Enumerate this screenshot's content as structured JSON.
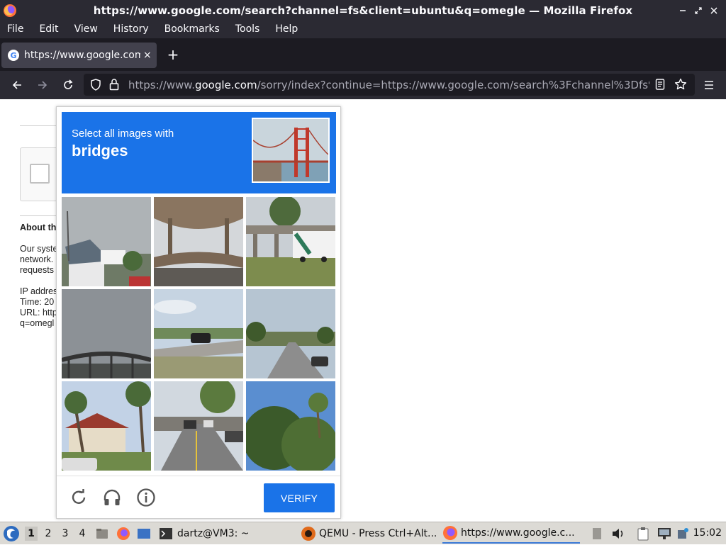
{
  "window": {
    "title": "https://www.google.com/search?channel=fs&client=ubuntu&q=omegle — Mozilla Firefox",
    "controls": {
      "minimize": "‒",
      "maximize": "⤡",
      "close": "✕"
    }
  },
  "menubar": {
    "items": [
      "File",
      "Edit",
      "View",
      "History",
      "Bookmarks",
      "Tools",
      "Help"
    ]
  },
  "tab": {
    "title": "https://www.google.com/s",
    "favicon_letter": "G",
    "close": "×",
    "new_tab": "+"
  },
  "urlbar": {
    "prefix": "https://www.",
    "host": "google.com",
    "path": "/sorry/index?continue=https://www.google.com/search%3Fchannel%3Dfs%26client%3Dubuntu%26q%3Domegle"
  },
  "background_page": {
    "heading": "About th",
    "line1": "Our syste",
    "line2": "network.",
    "line3": "requests",
    "ip": "IP addres",
    "time": "Time: 20",
    "url": "URL: http",
    "q": "q=omegl"
  },
  "captcha": {
    "instruction": "Select all images with",
    "object": "bridges",
    "verify_label": "VERIFY",
    "accent_color": "#1a73e8",
    "tiles": [
      "palm-houses-overcast",
      "overpass-underside",
      "overpass-with-truck",
      "bridge-silhouette-overcast",
      "grass-road-car",
      "road-with-cars",
      "house-with-palms",
      "street-with-cars",
      "trees-blue-sky"
    ]
  },
  "taskbar": {
    "workspaces": [
      "1",
      "2",
      "3",
      "4"
    ],
    "tasks": [
      {
        "label": "dartz@VM3: ~"
      },
      {
        "label": "QEMU - Press Ctrl+Alt..."
      },
      {
        "label": "https://www.google.c..."
      }
    ],
    "clock": "15:02"
  }
}
